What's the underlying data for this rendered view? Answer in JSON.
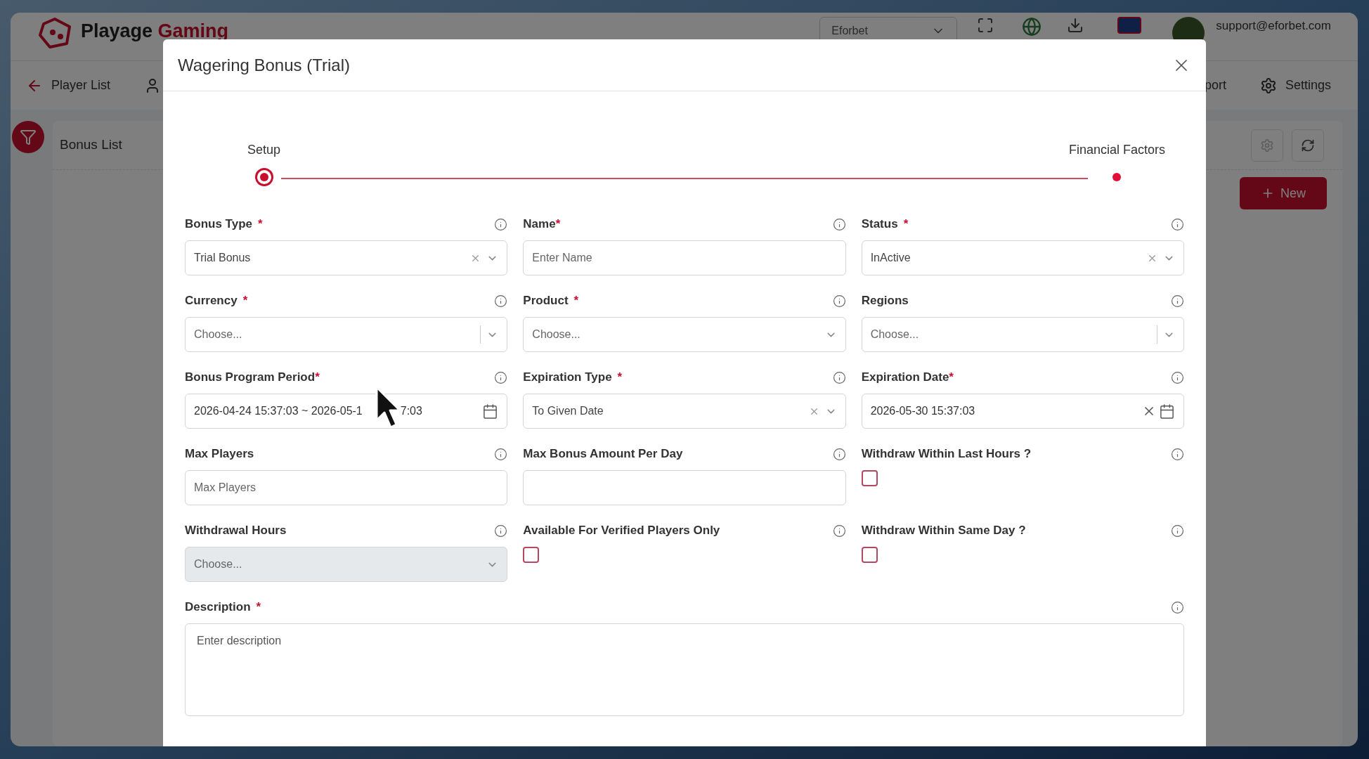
{
  "app": {
    "logo_text": "Playage",
    "logo_accent": "Gaming",
    "site_select": "Eforbet",
    "user_email": "support@eforbet.com"
  },
  "nav": {
    "back_label": "Player List",
    "partial_label": "port",
    "settings_label": "Settings"
  },
  "page": {
    "title": "Bonus List",
    "new_button": "New"
  },
  "modal": {
    "title": "Wagering Bonus (Trial)",
    "steps": [
      {
        "label": "Setup",
        "selected": true
      },
      {
        "label": "Financial Factors",
        "selected": false
      }
    ],
    "fields": [
      {
        "kind": "select",
        "label": "Bonus Type",
        "required_mark": "*",
        "tight_mark": false,
        "value": "Trial Bonus",
        "clearable": true,
        "separator": false,
        "disabled": false
      },
      {
        "kind": "text",
        "label": "Name",
        "required_mark": "*",
        "tight_mark": true,
        "placeholder": "Enter Name"
      },
      {
        "kind": "select",
        "label": "Status",
        "required_mark": "*",
        "tight_mark": false,
        "value": "InActive",
        "clearable": true,
        "separator": false,
        "disabled": false
      },
      {
        "kind": "select",
        "label": "Currency",
        "required_mark": "*",
        "tight_mark": false,
        "placeholder": "Choose...",
        "clearable": false,
        "separator": true,
        "disabled": false
      },
      {
        "kind": "select",
        "label": "Product",
        "required_mark": "*",
        "tight_mark": false,
        "placeholder": "Choose...",
        "clearable": false,
        "separator": false,
        "disabled": false
      },
      {
        "kind": "select",
        "label": "Regions",
        "placeholder": "Choose...",
        "clearable": false,
        "separator": true,
        "disabled": false
      },
      {
        "kind": "date",
        "label": "Bonus Program Period",
        "required_mark": "*",
        "tight_mark": true,
        "value_parts": [
          "2026-04-24 15:37:03 ~ 2026-05-1",
          "7:03"
        ],
        "clearable": false
      },
      {
        "kind": "select",
        "label": "Expiration Type",
        "required_mark": "*",
        "tight_mark": false,
        "value": "To Given Date",
        "clearable": true,
        "separator": false,
        "disabled": false
      },
      {
        "kind": "date",
        "label": "Expiration Date",
        "required_mark": "*",
        "tight_mark": true,
        "value_parts": [
          "2026-05-30 15:37:03"
        ],
        "clearable": true
      },
      {
        "kind": "text",
        "label": "Max Players",
        "placeholder": "Max Players"
      },
      {
        "kind": "text",
        "label": "Max Bonus Amount Per Day"
      },
      {
        "kind": "checkbox",
        "label": "Withdraw Within Last Hours ?",
        "checked": false
      },
      {
        "kind": "select",
        "label": "Withdrawal Hours",
        "placeholder": "Choose...",
        "clearable": false,
        "separator": false,
        "disabled": true
      },
      {
        "kind": "checkbox",
        "label": "Available For Verified Players Only",
        "checked": false
      },
      {
        "kind": "checkbox",
        "label": "Withdraw Within Same Day ?",
        "checked": false
      },
      {
        "kind": "textarea",
        "label": "Description",
        "required_mark": "*",
        "tight_mark": false,
        "placeholder": "Enter description",
        "wide": true
      }
    ]
  }
}
